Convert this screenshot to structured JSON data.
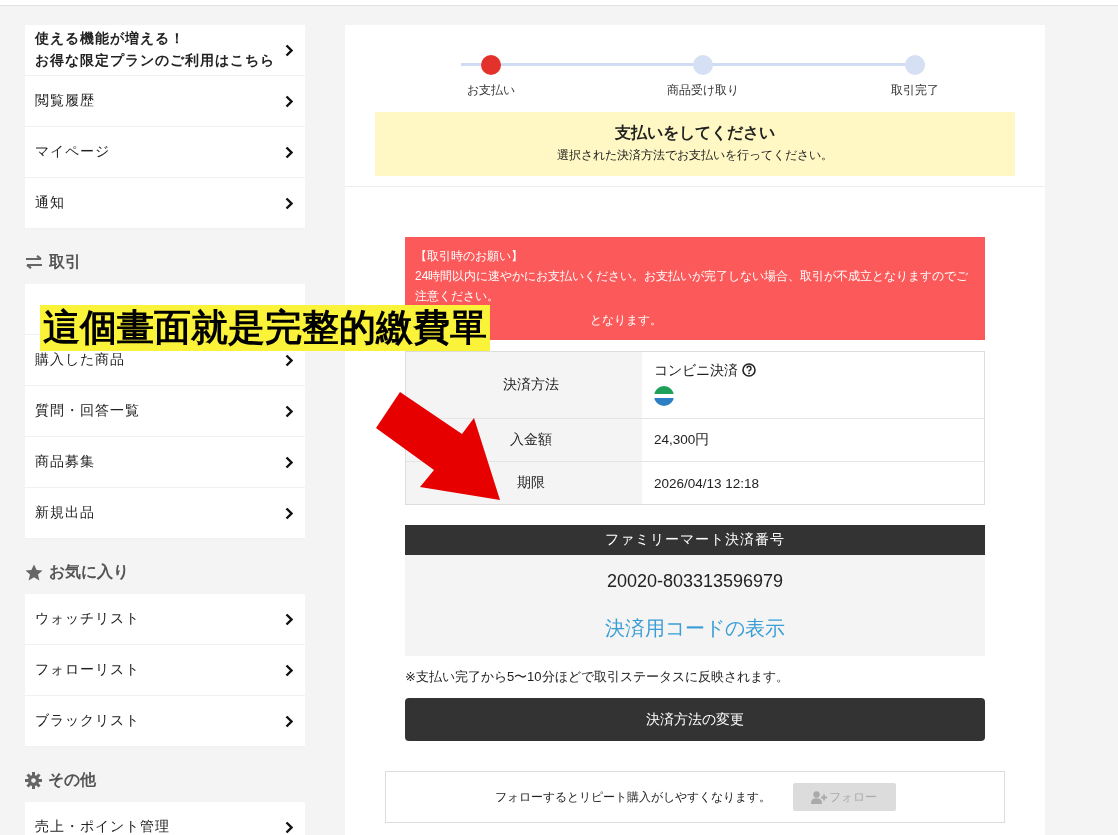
{
  "sidebar": {
    "top_items": [
      {
        "kind": "promo",
        "lines": [
          "使える機能が増える！",
          "お得な限定プランのご利用はこちら"
        ]
      },
      {
        "kind": "link",
        "label": "閲覧履歴"
      },
      {
        "kind": "link",
        "label": "マイページ"
      },
      {
        "kind": "link",
        "label": "通知"
      }
    ],
    "sections": [
      {
        "title": "取引",
        "items": [
          {
            "kind": "covered"
          },
          {
            "kind": "link",
            "label": "購入した商品"
          },
          {
            "kind": "link",
            "label": "質問・回答一覧"
          },
          {
            "kind": "link",
            "label": "商品募集"
          },
          {
            "kind": "link",
            "label": "新規出品"
          }
        ]
      },
      {
        "title": "お気に入り",
        "items": [
          {
            "kind": "link",
            "label": "ウォッチリスト"
          },
          {
            "kind": "link",
            "label": "フォローリスト"
          },
          {
            "kind": "link",
            "label": "ブラックリスト"
          }
        ]
      },
      {
        "title": "その他",
        "items": [
          {
            "kind": "link",
            "label": "売上・ポイント管理"
          }
        ]
      }
    ]
  },
  "steps": [
    {
      "label": "お支払い",
      "selected": true
    },
    {
      "label": "商品受け取り",
      "selected": false
    },
    {
      "label": "取引完了",
      "selected": false
    }
  ],
  "status_box": {
    "title": "支払いをしてください",
    "subtitle": "選択された決済方法でお支払いを行ってください。"
  },
  "notice": {
    "title": "【取引時のお願い】",
    "body": "24時間以内に速やかにお支払いください。お支払いが完了しない場合、取引が不成立となりますのでご注意ください。",
    "tail": "となります。"
  },
  "details": [
    {
      "kind": "method",
      "label": "決済方法",
      "value": "コンビニ決済"
    },
    {
      "kind": "text",
      "label": "入金額",
      "value": "24,300円"
    },
    {
      "kind": "text",
      "label": "期限",
      "value": "2026/04/13 12:18"
    }
  ],
  "payment_code": {
    "header": "ファミリーマート決済番号",
    "number": "20020-803313596979",
    "link": "決済用コードの表示"
  },
  "note": "※支払い完了から5〜10分ほどで取引ステータスに反映されます。",
  "change_button": "決済方法の変更",
  "follow": {
    "text": "フォローするとリピート購入がしやすくなります。",
    "button": "フォロー",
    "disabled": true
  },
  "annotation": {
    "text": "這個畫面就是完整的繳費單"
  }
}
